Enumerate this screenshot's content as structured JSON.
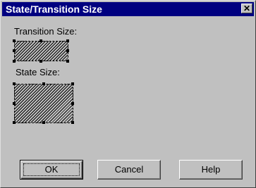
{
  "window": {
    "title": "State/Transition Size",
    "close_label": "✕"
  },
  "labels": {
    "transition_size": "Transition Size:",
    "state_size": "State Size:"
  },
  "buttons": {
    "ok": "OK",
    "cancel": "Cancel",
    "help": "Help"
  },
  "colors": {
    "titlebar": "#000080",
    "face": "#c0c0c0"
  }
}
